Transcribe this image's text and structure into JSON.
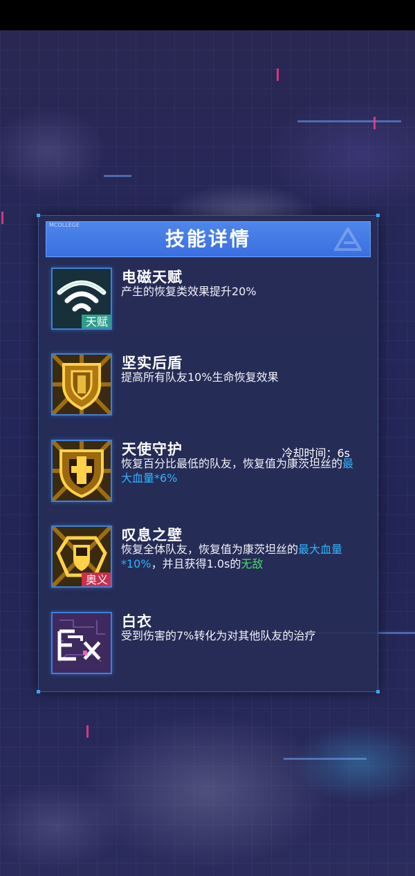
{
  "header": {
    "logo_text": "MCOLLEGE",
    "title": "技能详情"
  },
  "skills": [
    {
      "name": "电磁天赋",
      "tag": "天赋",
      "icon": "wifi-signal-icon",
      "desc": "产生的恢复类效果提升20%"
    },
    {
      "name": "坚实后盾",
      "icon": "shield-icon",
      "desc": "提高所有队友10%生命恢复效果"
    },
    {
      "name": "天使守护",
      "icon": "guardian-shield-icon",
      "cooldown": "冷却时间：6s",
      "desc_part1": "恢复百分比最低的队友，恢复值为康茨坦丝的",
      "desc_highlight": "最大血量*6%"
    },
    {
      "name": "叹息之壁",
      "tag": "奥义",
      "icon": "barrier-wall-icon",
      "desc_part1": "恢复全体队友，恢复值为康茨坦丝的",
      "desc_highlight1": "最大血量*10%",
      "desc_part2": "，并且获得1.0s的",
      "desc_highlight2": "无敌"
    },
    {
      "name": "白衣",
      "icon": "ex-icon",
      "desc": "受到伤害的7%转化为对其他队友的治疗"
    }
  ],
  "colors": {
    "header_blue": "#3a6fe0",
    "highlight_blue": "#31b3ff",
    "highlight_green": "#4bd96b",
    "tag_talent": "#2f9e8a",
    "tag_ultimate": "#c9304c",
    "icon_gold": "#d9a21c"
  }
}
